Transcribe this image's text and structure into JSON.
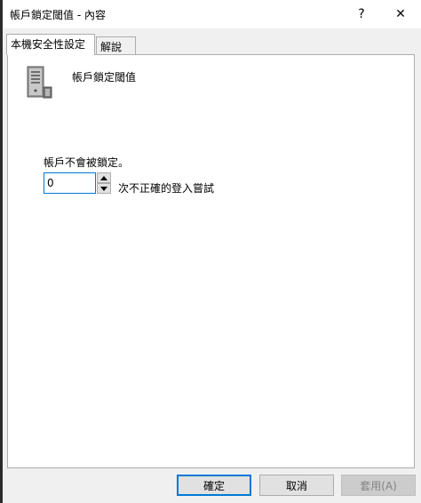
{
  "window": {
    "title": "帳戶鎖定閾值 - 內容",
    "help_label": "?",
    "close_label": "✕"
  },
  "tabs": [
    {
      "label": "本機安全性設定"
    },
    {
      "label": "解說"
    }
  ],
  "policy": {
    "name": "帳戶鎖定閾值",
    "icon": "server-icon"
  },
  "setting": {
    "label": "帳戶不會被鎖定。",
    "value": "0",
    "suffix": "次不正確的登入嘗試"
  },
  "buttons": {
    "ok": "確定",
    "cancel": "取消",
    "apply": "套用(A)"
  },
  "colors": {
    "accent": "#0078d7"
  }
}
